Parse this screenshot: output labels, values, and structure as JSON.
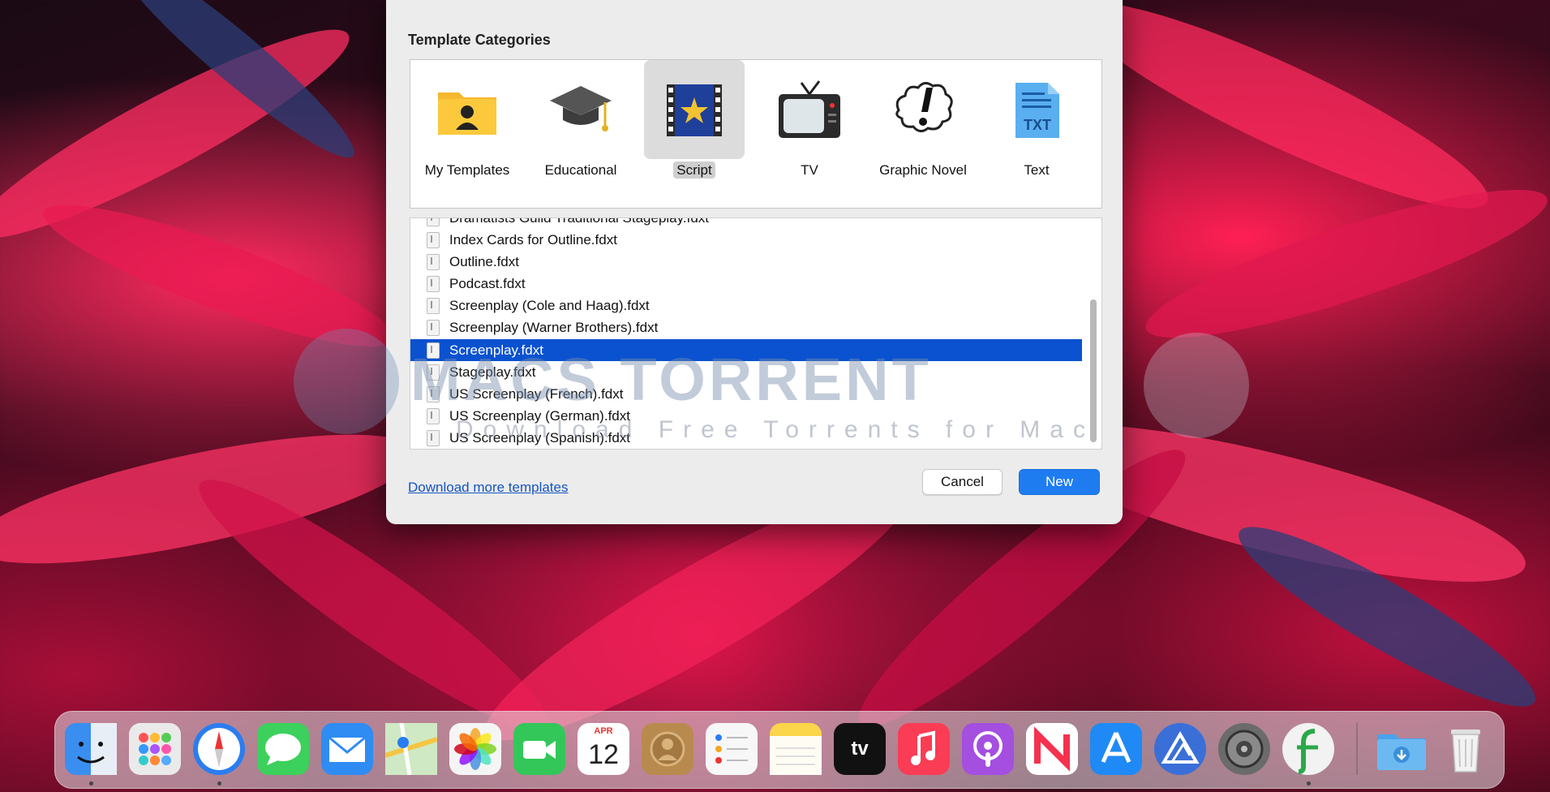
{
  "dialog": {
    "categories_title": "Template Categories",
    "categories": [
      {
        "label": "My Templates",
        "icon": "folder-person-icon",
        "selected": false
      },
      {
        "label": "Educational",
        "icon": "graduation-cap-icon",
        "selected": false
      },
      {
        "label": "Script",
        "icon": "film-star-icon",
        "selected": true
      },
      {
        "label": "TV",
        "icon": "television-icon",
        "selected": false
      },
      {
        "label": "Graphic Novel",
        "icon": "comic-burst-icon",
        "selected": false
      },
      {
        "label": "Text",
        "icon": "txt-document-icon",
        "selected": false
      }
    ],
    "files": [
      {
        "name": "Dramatists Guild Traditional Stageplay.fdxt",
        "selected": false
      },
      {
        "name": "Index Cards for Outline.fdxt",
        "selected": false
      },
      {
        "name": "Outline.fdxt",
        "selected": false
      },
      {
        "name": "Podcast.fdxt",
        "selected": false
      },
      {
        "name": "Screenplay (Cole and Haag).fdxt",
        "selected": false
      },
      {
        "name": "Screenplay (Warner Brothers).fdxt",
        "selected": false
      },
      {
        "name": "Screenplay.fdxt",
        "selected": true
      },
      {
        "name": "Stageplay.fdxt",
        "selected": false
      },
      {
        "name": "US Screenplay (French).fdxt",
        "selected": false
      },
      {
        "name": "US Screenplay (German).fdxt",
        "selected": false
      },
      {
        "name": "US Screenplay (Spanish).fdxt",
        "selected": false
      }
    ],
    "download_link": "Download more templates",
    "cancel_label": "Cancel",
    "new_label": "New"
  },
  "watermark": {
    "title": "MACS TORRENT",
    "subtitle": "Download Free Torrents for Mac"
  },
  "dock": {
    "apps": [
      {
        "name": "finder-icon",
        "color": "#3a8ef0",
        "running": true
      },
      {
        "name": "launchpad-icon",
        "color": "#eaeaea",
        "running": false
      },
      {
        "name": "safari-icon",
        "color": "#2a7df0",
        "running": true
      },
      {
        "name": "messages-icon",
        "color": "#3bd15c",
        "running": false
      },
      {
        "name": "mail-icon",
        "color": "#2f8cf2",
        "running": false
      },
      {
        "name": "maps-icon",
        "color": "#7fcf7a",
        "running": false
      },
      {
        "name": "photos-icon",
        "color": "#f5f5f5",
        "running": false
      },
      {
        "name": "facetime-icon",
        "color": "#33c759",
        "running": false
      },
      {
        "name": "calendar-icon",
        "color": "#ffffff",
        "running": false
      },
      {
        "name": "contacts-icon",
        "color": "#b88a4e",
        "running": false
      },
      {
        "name": "reminders-icon",
        "color": "#f7f7f7",
        "running": false
      },
      {
        "name": "notes-icon",
        "color": "#fbd54a",
        "running": false
      },
      {
        "name": "apple-tv-icon",
        "color": "#111111",
        "running": false
      },
      {
        "name": "music-icon",
        "color": "#fa3c55",
        "running": false
      },
      {
        "name": "podcasts-icon",
        "color": "#a44fe0",
        "running": false
      },
      {
        "name": "news-icon",
        "color": "#ffffff",
        "running": false
      },
      {
        "name": "app-store-icon",
        "color": "#1f8af5",
        "running": false
      },
      {
        "name": "drive-app-icon",
        "color": "#3a6fd8",
        "running": false
      },
      {
        "name": "system-preferences-icon",
        "color": "#6b6b6b",
        "running": false
      },
      {
        "name": "final-draft-icon",
        "color": "#f2f2f2",
        "running": true
      }
    ],
    "calendar_month": "APR",
    "calendar_day": "12",
    "tv_label": "tv",
    "downloads_folder": "downloads-folder-icon",
    "trash": "trash-icon"
  }
}
